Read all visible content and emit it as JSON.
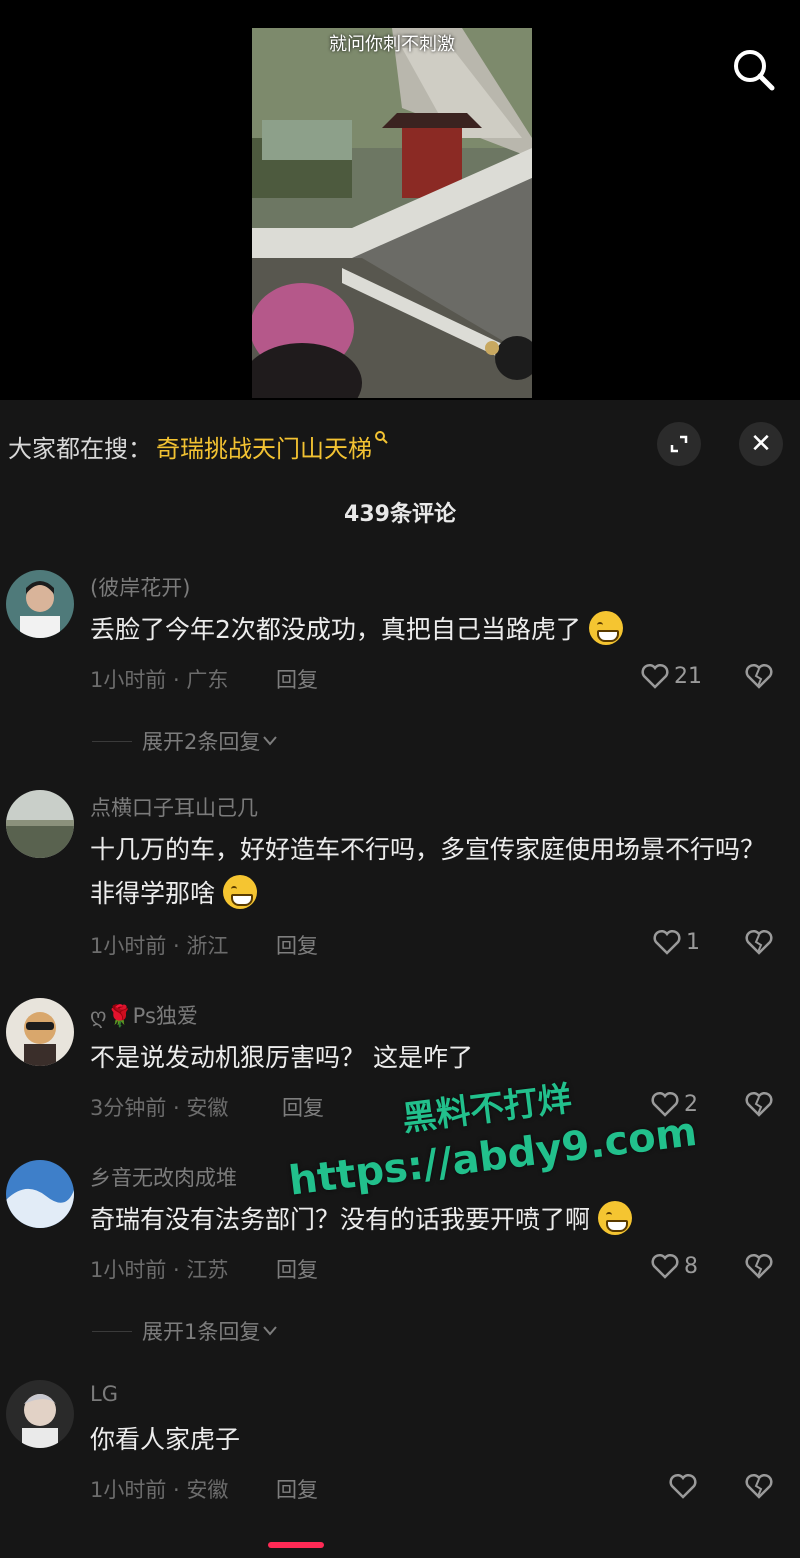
{
  "video": {
    "caption": "就问你刺不刺激"
  },
  "hot_search": {
    "prefix": "大家都在搜：",
    "term": "奇瑞挑战天门山天梯",
    "icon": "search-small-icon"
  },
  "panel": {
    "comment_count": "439条评论",
    "expand_icon": "expand-icon",
    "close_icon": "close-icon",
    "close_label": "✕"
  },
  "comments": [
    {
      "username": "(彼岸花开)",
      "text": "丢脸了今年2次都没成功，真把自己当路虎了",
      "emoji": "crying-laughing-emoji",
      "time_location": "1小时前 · 广东",
      "reply_label": "回复",
      "likes": "21",
      "expand_replies": "展开2条回复"
    },
    {
      "username": "点横口子耳山己几",
      "text": "十几万的车，好好造车不行吗，多宣传家庭使用场景不行吗？非得学那啥",
      "emoji": "grinning-sweat-emoji",
      "time_location": "1小时前 · 浙江",
      "reply_label": "回复",
      "likes": "1"
    },
    {
      "username": "ღ🌹Ps独爱",
      "text": "不是说发动机狠厉害吗？ 这是咋了",
      "time_location": "3分钟前 · 安徽",
      "reply_label": "回复",
      "likes": "2"
    },
    {
      "username": "乡音无改肉成堆",
      "text": "奇瑞有没有法务部门？没有的话我要开喷了啊",
      "emoji": "grimacing-emoji",
      "time_location": "1小时前 · 江苏",
      "reply_label": "回复",
      "likes": "8",
      "expand_replies": "展开1条回复"
    },
    {
      "username": "LG",
      "text": "你看人家虎子",
      "time_location": "1小时前 · 安徽",
      "reply_label": "回复",
      "likes": ""
    }
  ],
  "watermark": {
    "line1": "黑料不打烊",
    "line2": "https://abdy9.com"
  },
  "colors": {
    "accent": "#f2c232",
    "watermark": "#22c08c",
    "background": "#161616"
  }
}
